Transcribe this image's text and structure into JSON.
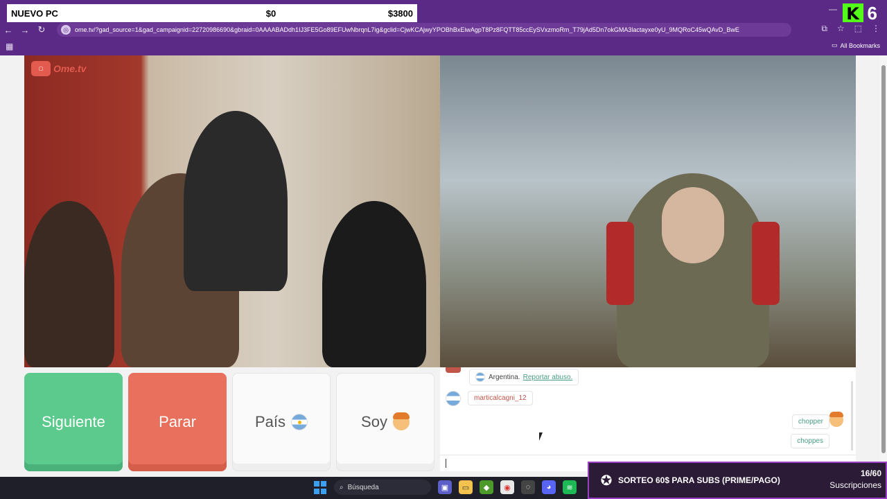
{
  "overlay": {
    "title": "NUEVO PC",
    "current": "$0",
    "goal": "$3800"
  },
  "stream": {
    "badge_number": "6"
  },
  "browser": {
    "url": "ome.tv/?gad_source=1&gad_campaignid=22720986690&gbraid=0AAAABADdh1IJ3FE5Go89EFUwNbrqnL7ig&gclid=CjwKCAjwyYPOBhBxEiwAgpT8Pz8FQTT85ccEySVxzmoRm_T79jAd5Dn7okGMA3lactayxe0yU_9MQRoC45wQAvD_BwE",
    "all_bookmarks": "All Bookmarks"
  },
  "site": {
    "logo_text": "Ome.tv"
  },
  "controls": {
    "next": "Siguiente",
    "stop": "Parar",
    "country": "País",
    "soy": "Soy"
  },
  "chat": {
    "country_text": "Argentina.",
    "report_link": "Reportar abuso.",
    "partner_username": "marticalcagni_12",
    "my_messages": [
      "chopper",
      "choppes"
    ]
  },
  "taskbar": {
    "search_placeholder": "Búsqueda"
  },
  "sub_goal": {
    "text": "SORTEO 60$ PARA SUBS (PRIME/PAGO)",
    "count": "16/60",
    "label": "Suscripciones"
  }
}
